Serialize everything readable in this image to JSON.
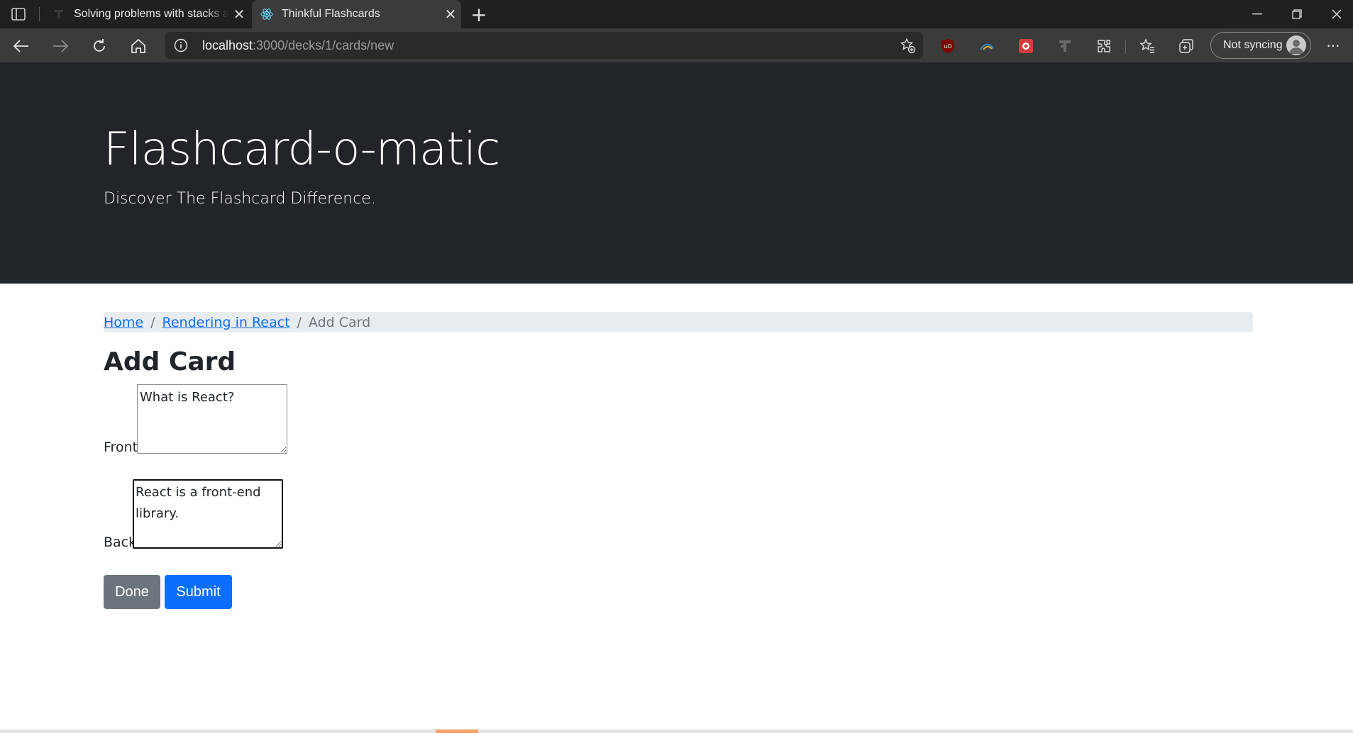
{
  "browser": {
    "tabs": [
      {
        "title": "Solving problems with stacks and",
        "icon": "thinkful-icon",
        "active": false
      },
      {
        "title": "Thinkful Flashcards",
        "icon": "react-icon",
        "active": true
      }
    ],
    "address": {
      "host": "localhost",
      "path": ":3000/decks/1/cards/new"
    },
    "profile_label": "Not syncing",
    "extensions": [
      "ublock-icon",
      "rainbow-extension-icon",
      "puzzle-red-extension-icon",
      "thinkful-extension-icon"
    ]
  },
  "header": {
    "title": "Flashcard-o-matic",
    "subtitle": "Discover The Flashcard Difference."
  },
  "breadcrumb": {
    "home": "Home",
    "deck": "Rendering in React",
    "current": "Add Card",
    "separator": "/"
  },
  "form": {
    "heading": "Add Card",
    "front_label": "Front",
    "front_value": "What is React?",
    "back_label": "Back",
    "back_value": "React is a front-end library.",
    "done_label": "Done",
    "submit_label": "Submit"
  },
  "colors": {
    "jumbotron": "#212529",
    "primary": "#0d6efd",
    "secondary": "#6c757d"
  }
}
